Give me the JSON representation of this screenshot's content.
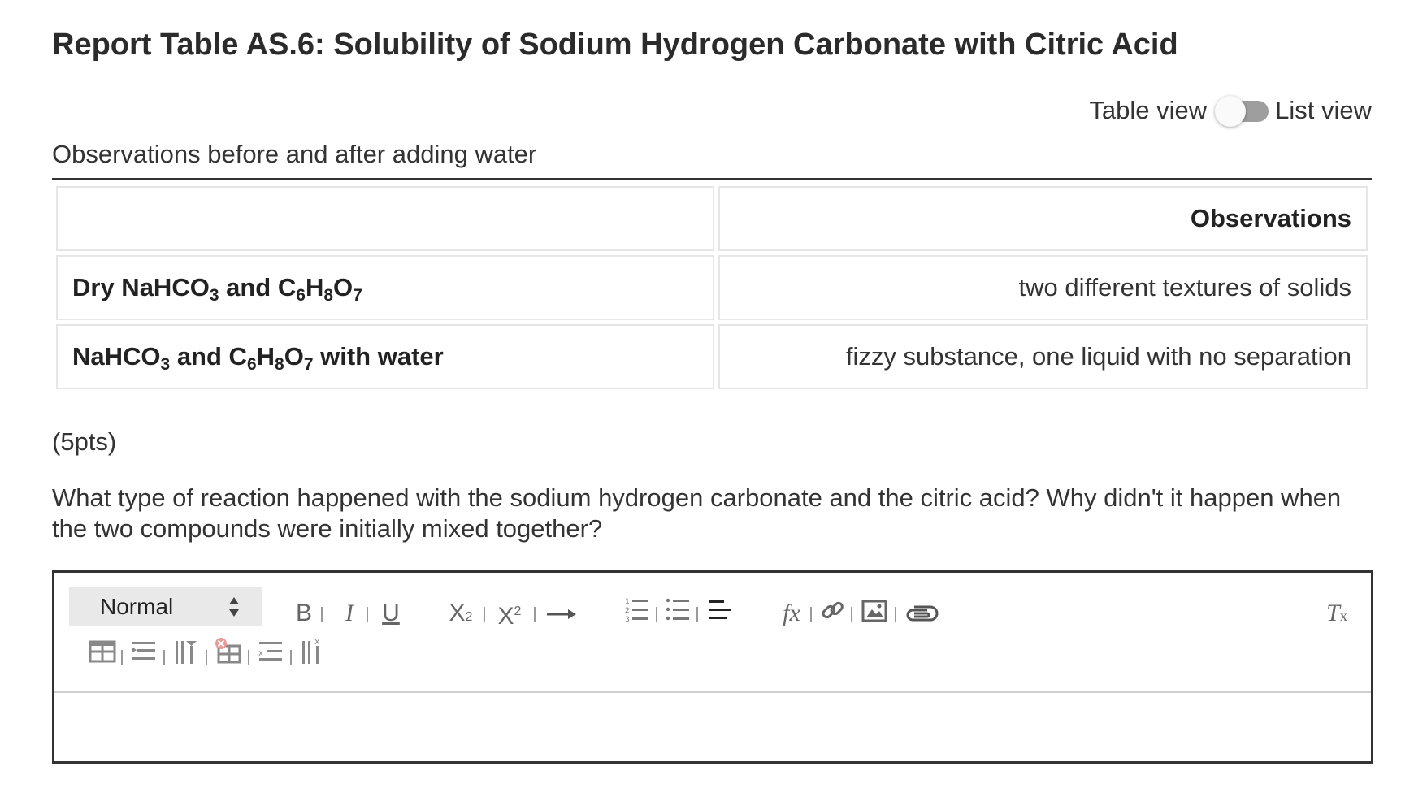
{
  "title": "Report Table AS.6: Solubility of Sodium Hydrogen Carbonate with Citric Acid",
  "view_toggle": {
    "left_label": "Table view",
    "right_label": "List view"
  },
  "table": {
    "caption": "Observations before and after adding water",
    "header": [
      "",
      "Observations"
    ],
    "rows": [
      {
        "label_parts": [
          "Dry NaHCO",
          "3",
          " and C",
          "6",
          "H",
          "8",
          "O",
          "7",
          ""
        ],
        "observation": "two different textures of solids"
      },
      {
        "label_parts": [
          "NaHCO",
          "3",
          " and C",
          "6",
          "H",
          "8",
          "O",
          "7",
          " with water"
        ],
        "observation": "fizzy substance, one liquid with no separation"
      }
    ]
  },
  "points": "(5pts)",
  "question": "What type of reaction happened with the sodium hydrogen carbonate and the citric acid? Why didn't it happen when the two compounds were initially mixed together?",
  "editor": {
    "format_value": "Normal",
    "answer_text": ""
  }
}
